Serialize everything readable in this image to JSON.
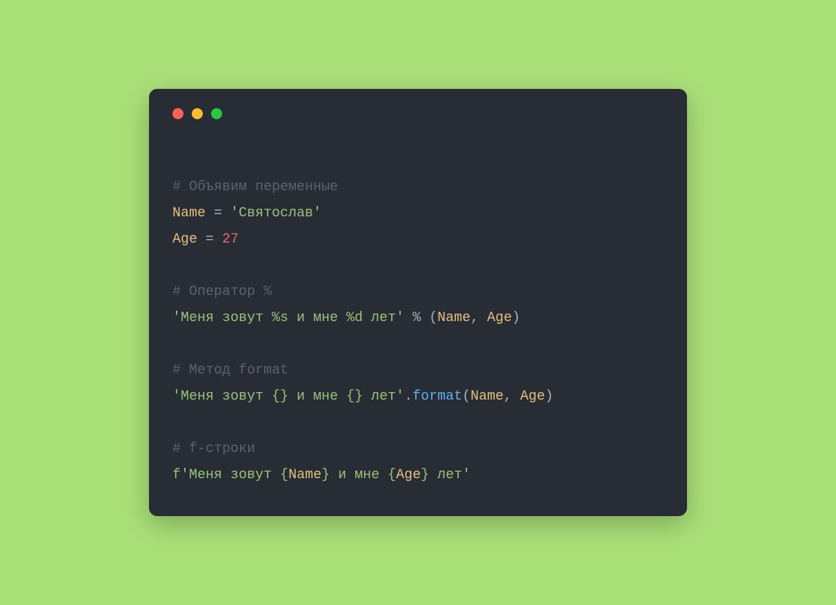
{
  "traffic": {
    "red": "#ff5f56",
    "yellow": "#ffbd2e",
    "green": "#27c93f"
  },
  "code": {
    "l1_comment": "# Объявим переменные",
    "l2_var": "Name",
    "l2_eq": " = ",
    "l2_str": "'Святослав'",
    "l3_var": "Age",
    "l3_eq": " = ",
    "l3_num": "27",
    "l5_comment": "# Оператор %",
    "l6_str": "'Меня зовут %s и мне %d лет'",
    "l6_op": " % (",
    "l6_a1": "Name",
    "l6_comma": ", ",
    "l6_a2": "Age",
    "l6_close": ")",
    "l8_comment": "# Метод format",
    "l9_str": "'Меня зовут {} и мне {} лет'",
    "l9_dot": ".",
    "l9_fn": "format",
    "l9_open": "(",
    "l9_a1": "Name",
    "l9_comma": ", ",
    "l9_a2": "Age",
    "l9_close": ")",
    "l11_comment": "# f-строки",
    "l12_f": "f",
    "l12_s1": "'Меня зовут ",
    "l12_b1o": "{",
    "l12_i1": "Name",
    "l12_b1c": "}",
    "l12_s2": " и мне ",
    "l12_b2o": "{",
    "l12_i2": "Age",
    "l12_b2c": "}",
    "l12_s3": " лет'"
  }
}
